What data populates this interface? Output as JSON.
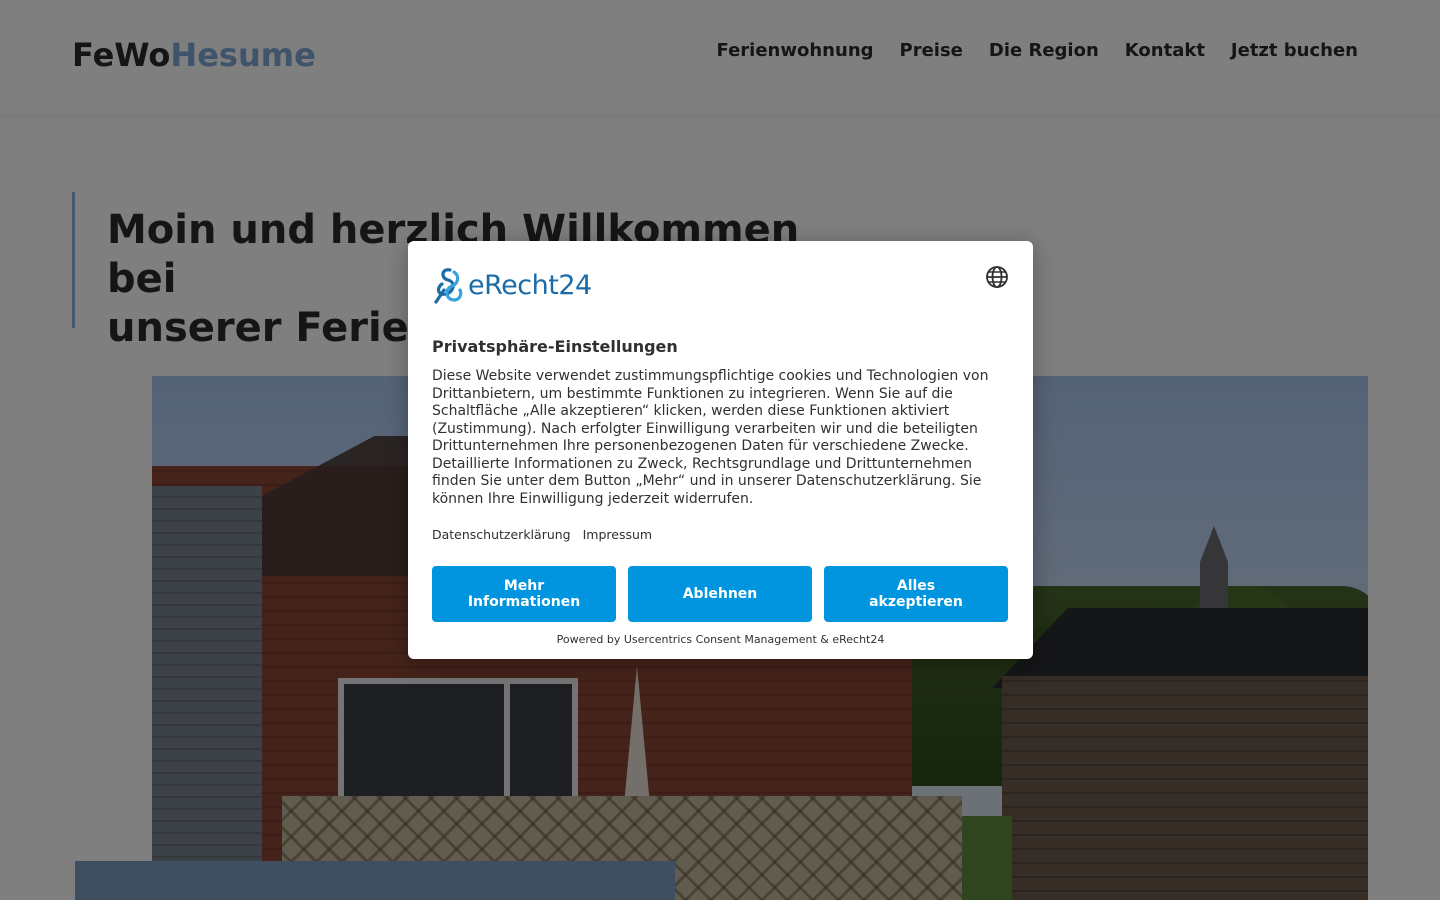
{
  "header": {
    "logo_part1": "FeWo",
    "logo_part2": "Hesume",
    "nav": [
      "Ferienwohnung",
      "Preise",
      "Die Region",
      "Kontakt",
      "Jetzt buchen"
    ]
  },
  "hero": {
    "heading_line1": "Moin und herzlich Willkommen bei",
    "heading_line2": "unserer Ferienwohnung"
  },
  "consent": {
    "brand": "eRecht24",
    "title": "Privatsphäre-Einstellungen",
    "body": "Diese Website verwendet zustimmungspflichtige cookies und Technologien von Drittanbietern, um bestimmte Funktionen zu integrieren. Wenn Sie auf die Schaltfläche „Alle akzeptieren“ klicken, werden diese Funktionen aktiviert (Zustimmung). Nach erfolgter Einwilligung verarbeiten wir und die beteiligten Drittunternehmen Ihre personenbezogenen Daten für verschiedene Zwecke. Detaillierte Informationen zu Zweck, Rechtsgrundlage und Drittunternehmen finden Sie unter dem Button „Mehr“ und in unserer Datenschutzerklärung. Sie können Ihre Einwilligung jederzeit widerrufen.",
    "link_privacy": "Datenschutzerklärung",
    "link_imprint": "Impressum",
    "btn_more": "Mehr Informationen",
    "btn_deny": "Ablehnen",
    "btn_accept": "Alles akzeptieren",
    "powered_by": "Powered by Usercentrics Consent Management & eRecht24",
    "button_color": "#0095de"
  },
  "icons": {
    "language": "globe-icon"
  }
}
